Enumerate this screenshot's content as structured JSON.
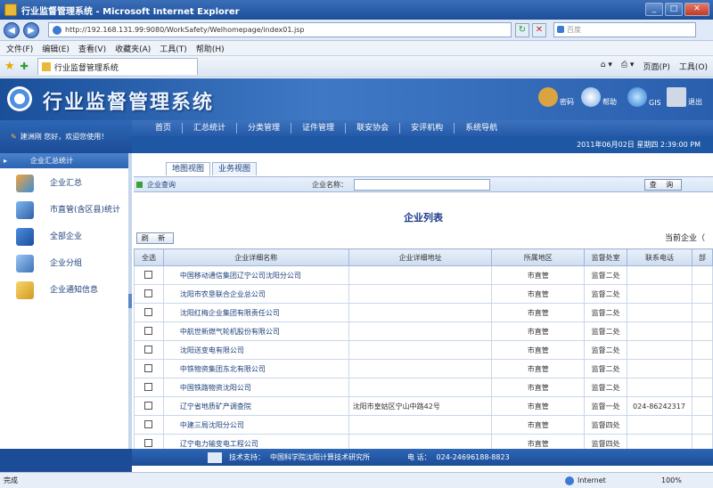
{
  "window": {
    "title": "行业监督管理系统 - Microsoft Internet Explorer"
  },
  "browser": {
    "address": "http://192.168.131.99:9080/WorkSafety/Welhomepage/index01.jsp",
    "search_placeholder": "百度",
    "menu": [
      "文件(F)",
      "编辑(E)",
      "查看(V)",
      "收藏夹(A)",
      "工具(T)",
      "帮助(H)"
    ],
    "tab_title": "行业监督管理系统",
    "tools": [
      "页面(P)",
      "工具(O)"
    ]
  },
  "app": {
    "title": "行业监督管理系统",
    "toolbar": {
      "password": "密码",
      "help": "帮助",
      "gis": "GIS",
      "exit": "退出"
    },
    "greeting": "建洲刚 您好，欢迎您使用！",
    "nav": [
      "首页",
      "汇总统计",
      "分类管理",
      "证件管理",
      "联安协会",
      "安评机构",
      "系统导航"
    ],
    "date": "2011年06月02日 星期四 2:39:00 PM"
  },
  "sidebar": {
    "header": "企业汇总统计",
    "items": [
      {
        "label": "企业汇总",
        "icon": "cube-icon"
      },
      {
        "label": "市直管(含区县)统计",
        "icon": "books-icon"
      },
      {
        "label": "全部企业",
        "icon": "book-icon"
      },
      {
        "label": "企业分组",
        "icon": "computer-icon"
      },
      {
        "label": "企业通知信息",
        "icon": "folder-icon"
      }
    ]
  },
  "main": {
    "tabs": [
      "地图视图",
      "业务视图"
    ],
    "query_label": "企业查询",
    "name_label": "企业名称：",
    "query_button": "查 询",
    "list_title": "企业列表",
    "refresh_button": "刷 新",
    "current_company": "当前企业（",
    "columns": [
      "全选",
      "企业详细名称",
      "企业详细地址",
      "所属地区",
      "监督处室",
      "联系电话",
      "部"
    ],
    "rows": [
      {
        "name": "中国移动通信集团辽宁公司沈阳分公司",
        "address": "",
        "region": "市直管",
        "dept": "监督二处",
        "phone": ""
      },
      {
        "name": "沈阳市农垦联合企业总公司",
        "address": "",
        "region": "市直管",
        "dept": "监督二处",
        "phone": ""
      },
      {
        "name": "沈阳红梅企业集团有限责任公司",
        "address": "",
        "region": "市直管",
        "dept": "监督二处",
        "phone": ""
      },
      {
        "name": "中航世新燃气轮机股份有限公司",
        "address": "",
        "region": "市直管",
        "dept": "监督二处",
        "phone": ""
      },
      {
        "name": "沈阳送变电有限公司",
        "address": "",
        "region": "市直管",
        "dept": "监督二处",
        "phone": ""
      },
      {
        "name": "中铁物资集团东北有限公司",
        "address": "",
        "region": "市直管",
        "dept": "监督二处",
        "phone": ""
      },
      {
        "name": "中国铁路物资沈阳公司",
        "address": "",
        "region": "市直管",
        "dept": "监督二处",
        "phone": ""
      },
      {
        "name": "辽宁省地质矿产调查院",
        "address": "沈阳市皇姑区宁山中路42号",
        "region": "市直管",
        "dept": "监督一处",
        "phone": "024-86242317"
      },
      {
        "name": "中建三局沈阳分公司",
        "address": "",
        "region": "市直管",
        "dept": "监督四处",
        "phone": ""
      },
      {
        "name": "辽宁电力输变电工程公司",
        "address": "",
        "region": "市直管",
        "dept": "监督四处",
        "phone": ""
      }
    ]
  },
  "footer": {
    "support_label": "技术支持：",
    "support_org": "中国科学院沈阳计算技术研究所",
    "phone_label": "电 话：",
    "phone": "024-24696188-8823"
  },
  "status": {
    "left": "完成",
    "zone": "Internet",
    "zoom": "100%"
  }
}
